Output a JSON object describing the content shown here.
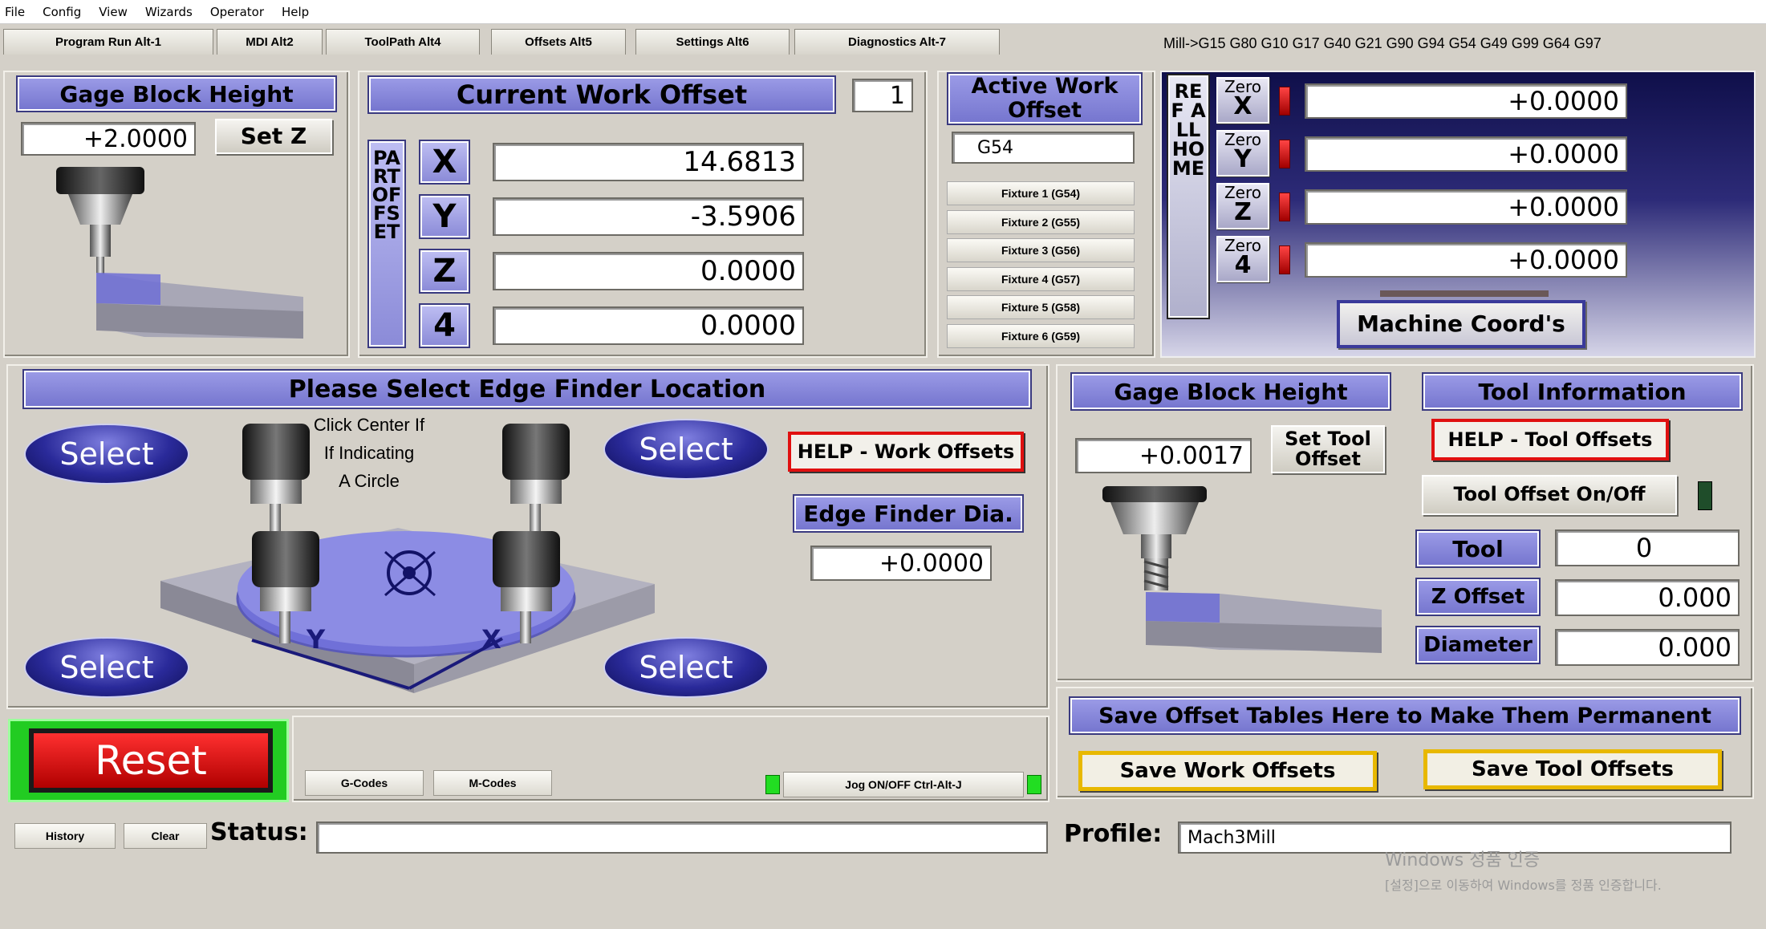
{
  "menu": [
    "File",
    "Config",
    "View",
    "Wizards",
    "Operator",
    "Help"
  ],
  "tabs": [
    "Program Run Alt-1",
    "MDI Alt2",
    "ToolPath Alt4",
    "Offsets Alt5",
    "Settings Alt6",
    "Diagnostics Alt-7"
  ],
  "mode_line": "Mill->G15  G80 G10 G17 G40 G21 G90 G94 G54 G49 G99 G64 G97",
  "gage_block_left": {
    "title": "Gage Block Height",
    "value": "+2.0000",
    "set_z": "Set Z"
  },
  "work_offset": {
    "title": "Current Work Offset",
    "number": "1",
    "side_label": "PART OFFSET",
    "axes": [
      {
        "axis": "X",
        "value": "14.6813"
      },
      {
        "axis": "Y",
        "value": "-3.5906"
      },
      {
        "axis": "Z",
        "value": "0.0000"
      },
      {
        "axis": "4",
        "value": "0.0000"
      }
    ]
  },
  "active_work_offset": {
    "title": "Active Work Offset",
    "value": "G54",
    "fixtures": [
      "Fixture 1 (G54)",
      "Fixture 2 (G55)",
      "Fixture 3 (G56)",
      "Fixture 4 (G57)",
      "Fixture 5 (G58)",
      "Fixture 6 (G59)"
    ]
  },
  "ref_all_home": "REF ALL HOME",
  "zero_buttons": [
    {
      "top": "Zero",
      "axis": "X",
      "value": "+0.0000"
    },
    {
      "top": "Zero",
      "axis": "Y",
      "value": "+0.0000"
    },
    {
      "top": "Zero",
      "axis": "Z",
      "value": "+0.0000"
    },
    {
      "top": "Zero",
      "axis": "4",
      "value": "+0.0000"
    }
  ],
  "machine_coords": "Machine Coord's",
  "edge_finder": {
    "title": "Please Select Edge Finder Location",
    "select_label": "Select",
    "center_note": [
      "Click Center If",
      "If Indicating",
      "A Circle"
    ],
    "help": "HELP - Work Offsets",
    "dia_title": "Edge Finder Dia.",
    "dia_value": "+0.0000",
    "axis_y": "Y",
    "axis_x": "X"
  },
  "gage_block_right": {
    "title": "Gage Block Height",
    "value": "+0.0017",
    "set_tool": "Set Tool Offset"
  },
  "tool_info": {
    "title": "Tool Information",
    "help": "HELP - Tool Offsets",
    "toggle": "Tool Offset On/Off",
    "tool_label": "Tool",
    "tool_value": "0",
    "zoffset_label": "Z Offset",
    "zoffset_value": "0.000",
    "diameter_label": "Diameter",
    "diameter_value": "0.000"
  },
  "save": {
    "title": "Save Offset Tables Here to Make Them Permanent",
    "work": "Save Work Offsets",
    "tool": "Save Tool Offsets"
  },
  "bottom": {
    "reset": "Reset",
    "gcodes": "G-Codes",
    "mcodes": "M-Codes",
    "jog": "Jog ON/OFF Ctrl-Alt-J",
    "history": "History",
    "clear": "Clear",
    "status_label": "Status:",
    "status_value": "",
    "profile_label": "Profile:",
    "profile_value": "Mach3Mill"
  },
  "watermark": [
    "Windows 정품 인증",
    "[설정]으로 이동하여 Windows를 정품 인증합니다."
  ],
  "colors": {
    "accent_blue": "#7676cf",
    "navy": "#1a1a5e",
    "led_red": "#e01010",
    "led_green": "#22dd22",
    "gold": "#e8b800"
  }
}
